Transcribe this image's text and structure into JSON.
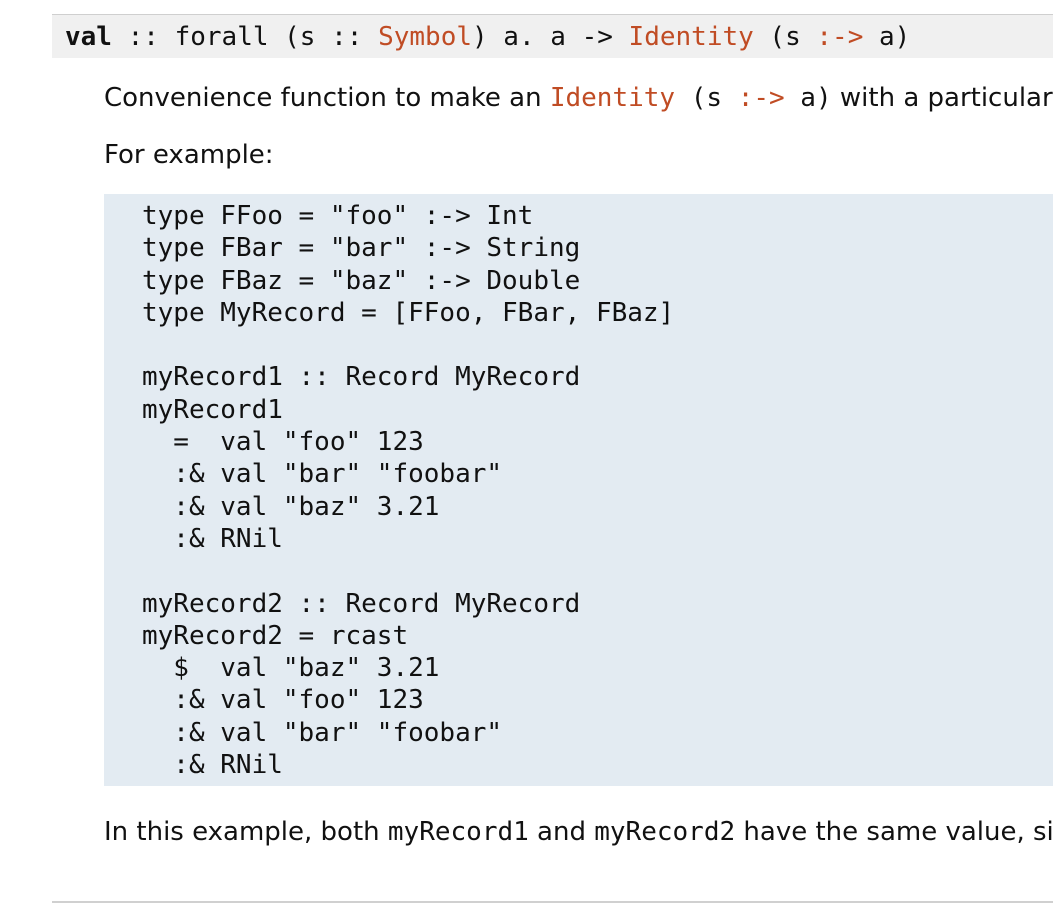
{
  "signature": {
    "name": "val",
    "sep1": " :: forall (s :: ",
    "symbol": "Symbol",
    "sep2": ") a. a -> ",
    "identity": "Identity",
    "sep3": " (s ",
    "op": ":->",
    "sep4": " a)"
  },
  "description": {
    "prefix": "Convenience function to make an ",
    "identity": "Identity",
    "code_a": " (s ",
    "op": ":->",
    "code_b": " a)",
    "suffix": " with a particular"
  },
  "example_intro": "For example:",
  "code_lines": [
    "type FFoo = \"foo\" :-> Int",
    "type FBar = \"bar\" :-> String",
    "type FBaz = \"baz\" :-> Double",
    "type MyRecord = [FFoo, FBar, FBaz]",
    "",
    "myRecord1 :: Record MyRecord",
    "myRecord1",
    "  =  val \"foo\" 123",
    "  :& val \"bar\" \"foobar\"",
    "  :& val \"baz\" 3.21",
    "  :& RNil",
    "",
    "myRecord2 :: Record MyRecord",
    "myRecord2 = rcast",
    "  $  val \"baz\" 3.21",
    "  :& val \"foo\" 123",
    "  :& val \"bar\" \"foobar\"",
    "  :& RNil"
  ],
  "conclusion": {
    "prefix": "In this example, both ",
    "rec1": "myRecord1",
    "middle": " and ",
    "rec2": "myRecord2",
    "suffix": " have the same value, si"
  }
}
